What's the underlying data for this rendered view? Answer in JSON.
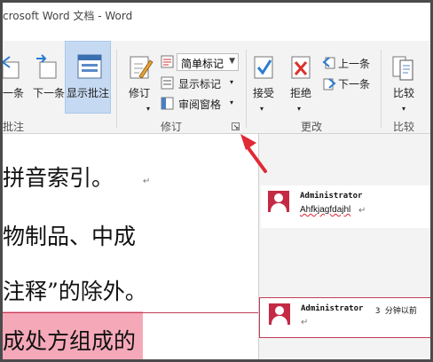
{
  "window": {
    "title": "crosoft Word 文档 - Word"
  },
  "ribbon": {
    "groups": {
      "comments": {
        "label": "批注"
      },
      "tracking": {
        "label": "修订"
      },
      "changes": {
        "label": "更改"
      },
      "compare": {
        "label": "比较"
      }
    },
    "buttons": {
      "prev_comment": "一条",
      "next_comment": "下一条",
      "show_comments": "显示批注",
      "track_changes": "修订",
      "show_markup": "显示标记",
      "review_pane": "审阅窗格",
      "accept": "接受",
      "reject": "拒绝",
      "previous": "上一条",
      "next": "下一条",
      "compare": "比较"
    },
    "markup_dropdown": {
      "value": "简单标记"
    }
  },
  "document": {
    "lines": [
      "拼音索引。",
      "物制品、中成",
      "注释”的除外。",
      "成处方组成的"
    ],
    "pilcrow": "↵"
  },
  "comments": [
    {
      "author": "Administrator",
      "time": "",
      "text": "Ahfkjagfdajhl",
      "mark": "↵"
    },
    {
      "author": "Administrator",
      "time": "3 分钟以前",
      "text": "",
      "mark": "↵"
    }
  ],
  "colors": {
    "accent": "#c42a45",
    "arrow": "#e02a35",
    "selected": "#c5daf2"
  }
}
